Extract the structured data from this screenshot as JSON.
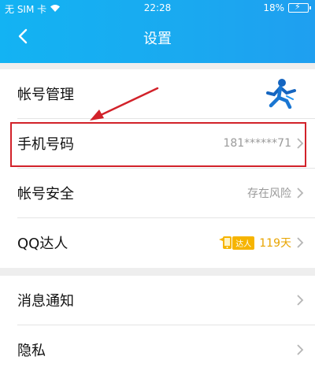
{
  "status": {
    "carrier": "无 SIM 卡",
    "time": "22:28",
    "battery": "18%"
  },
  "nav": {
    "title": "设置"
  },
  "rows": {
    "account_manage": {
      "label": "帐号管理"
    },
    "phone": {
      "label": "手机号码",
      "value": "181******71"
    },
    "security": {
      "label": "帐号安全",
      "value": "存在风险"
    },
    "daren": {
      "label": "QQ达人",
      "badge": "达人",
      "days": "119天"
    },
    "notify": {
      "label": "消息通知"
    },
    "privacy": {
      "label": "隐私"
    }
  },
  "colors": {
    "header": "#13b3f3",
    "highlight": "#d2222a",
    "daren_gold": "#f6b400"
  }
}
